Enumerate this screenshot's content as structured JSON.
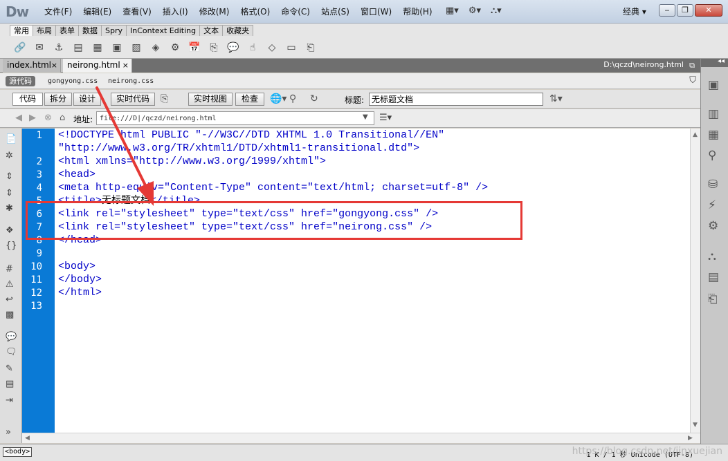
{
  "app": {
    "logo": "Dw",
    "menu": [
      "文件(F)",
      "编辑(E)",
      "查看(V)",
      "插入(I)",
      "修改(M)",
      "格式(O)",
      "命令(C)",
      "站点(S)",
      "窗口(W)",
      "帮助(H)"
    ],
    "workspace": "经典 ▾",
    "window_buttons": [
      "‒",
      "❐",
      "✕"
    ]
  },
  "insert_panel": {
    "tabs": [
      "常用",
      "布局",
      "表单",
      "数据",
      "Spry",
      "InContext Editing",
      "文本",
      "收藏夹"
    ],
    "active_tab": "常用"
  },
  "documents": {
    "tabs": [
      {
        "label": "index.html",
        "close": "×"
      },
      {
        "label": "neirong.html",
        "close": "×"
      }
    ],
    "path": "D:\\qczd\\neirong.html",
    "restore": "⧉"
  },
  "related_files": {
    "source_label": "源代码",
    "files": [
      "gongyong.css",
      "neirong.css"
    ]
  },
  "doc_toolbar": {
    "view_buttons": [
      "代码",
      "拆分",
      "设计",
      "实时代码",
      "实时视图",
      "检查"
    ],
    "title_label": "标题:",
    "title_value": "无标题文档"
  },
  "address_bar": {
    "label": "地址:",
    "value": "file:///D|/qczd/neirong.html"
  },
  "code": {
    "line_numbers": [
      "1",
      "2",
      "3",
      "4",
      "5",
      "6",
      "7",
      "8",
      "9",
      "10",
      "11",
      "12",
      "13"
    ],
    "lines": [
      "<!DOCTYPE html PUBLIC \"-//W3C//DTD XHTML 1.0 Transitional//EN\"",
      "\"http://www.w3.org/TR/xhtml1/DTD/xhtml1-transitional.dtd\">",
      "<html xmlns=\"http://www.w3.org/1999/xhtml\">",
      "<head>",
      "<meta http-equiv=\"Content-Type\" content=\"text/html; charset=utf-8\" />",
      "<title>",
      "<link rel=\"stylesheet\" type=\"text/css\" href=\"gongyong.css\" />",
      "<link rel=\"stylesheet\" type=\"text/css\" href=\"neirong.css\" />",
      "</head>",
      "",
      "<body>",
      "</body>",
      "</html>"
    ],
    "title_text": "无标题文档",
    "title_close": "</title>"
  },
  "status": {
    "tag": "<body>",
    "info": "1 K / 1 秒 Unicode (UTF-8)",
    "watermark": "https://blog.csdn.net/jinxuejian"
  },
  "colors": {
    "annotation": "#e53935",
    "gutter": "#0a7ad6",
    "code_text": "#0000c8"
  }
}
